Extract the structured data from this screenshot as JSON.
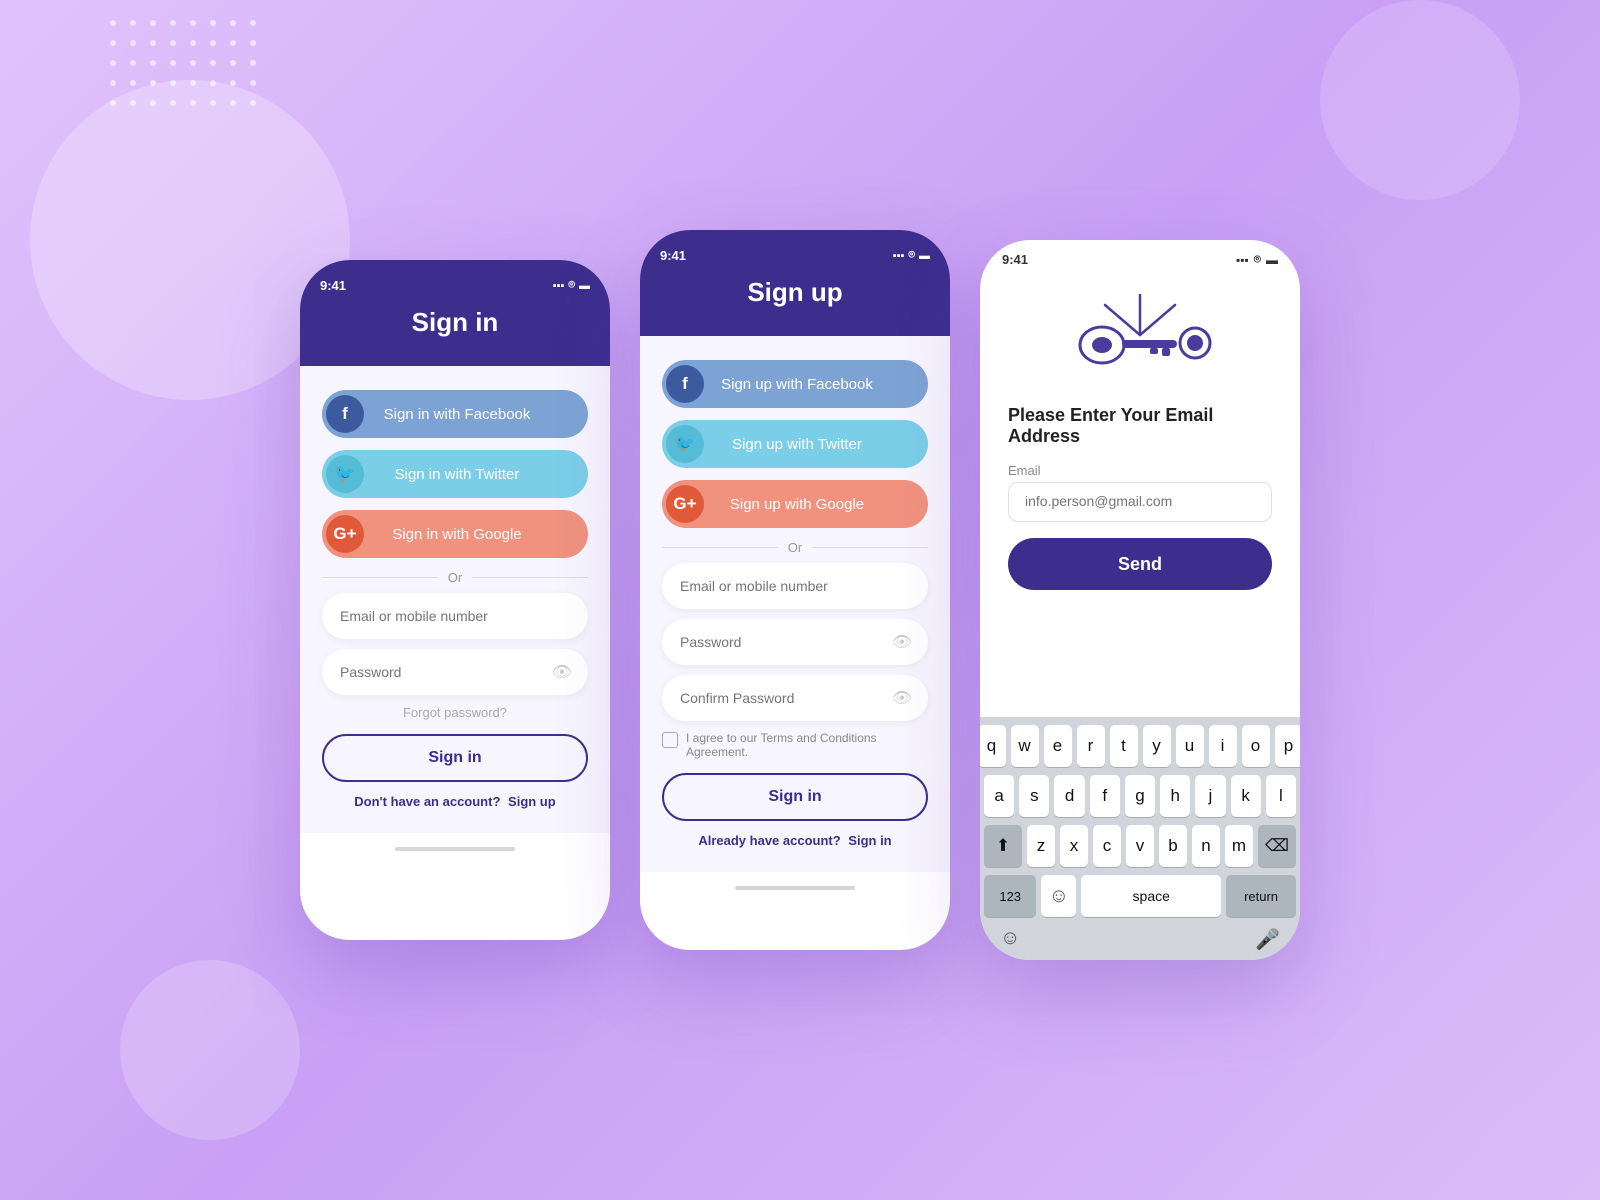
{
  "background": {
    "color": "#d4b0f7"
  },
  "phone1": {
    "status_time": "9:41",
    "title": "Sign in",
    "facebook_btn": "Sign in with Facebook",
    "twitter_btn": "Sign in with Twitter",
    "google_btn": "Sign in with Google",
    "divider": "Or",
    "email_placeholder": "Email or mobile number",
    "password_placeholder": "Password",
    "forgot_password": "Forgot password?",
    "signin_btn": "Sign in",
    "bottom_text": "Don't have an account?",
    "signup_link": "Sign up"
  },
  "phone2": {
    "status_time": "9:41",
    "title": "Sign up",
    "facebook_btn": "Sign up with Facebook",
    "twitter_btn": "Sign up with Twitter",
    "google_btn": "Sign up with Google",
    "divider": "Or",
    "email_placeholder": "Email or mobile number",
    "password_placeholder": "Password",
    "confirm_placeholder": "Confirm Password",
    "terms_text": "I agree to our Terms and Conditions Agreement.",
    "signin_btn": "Sign in",
    "bottom_text": "Already have account?",
    "signin_link": "Sign in"
  },
  "phone3": {
    "status_time": "9:41",
    "title": "Please Enter Your Email Address",
    "email_label": "Email",
    "email_placeholder": "info.person@gmail.com",
    "send_btn": "Send",
    "keyboard": {
      "row1": [
        "q",
        "w",
        "e",
        "r",
        "t",
        "y",
        "u",
        "i",
        "o",
        "p"
      ],
      "row2": [
        "a",
        "s",
        "d",
        "f",
        "g",
        "h",
        "j",
        "k",
        "l"
      ],
      "row3": [
        "z",
        "x",
        "c",
        "v",
        "b",
        "n",
        "m"
      ],
      "row4_left": "123",
      "row4_space": "space",
      "row4_return": "return"
    }
  }
}
